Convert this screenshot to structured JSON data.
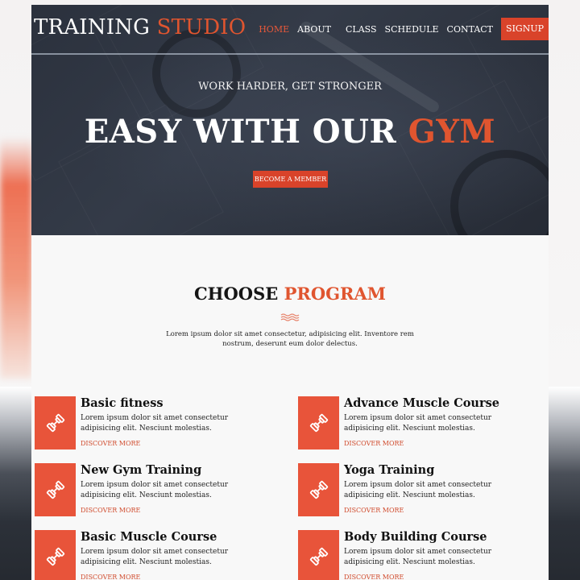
{
  "brand": {
    "name": "TRAINING",
    "accent": "STUDIO"
  },
  "nav": {
    "items": [
      "HOME",
      "ABOUT",
      "CLASS",
      "SCHEDULE",
      "CONTACT"
    ],
    "signup": "SIGNUP"
  },
  "hero": {
    "subtitle": "WORK HARDER, GET STRONGER",
    "title": "EASY WITH OUR",
    "title_accent": "GYM",
    "button": "BECOME A MEMBER"
  },
  "programs_section": {
    "title": "CHOOSE",
    "title_accent": "PROGRAM",
    "description": "Lorem ipsum dolor sit amet consectetur, adipisicing elit. Inventore rem nostrum, deserunt eum dolor delectus."
  },
  "programs": [
    {
      "title": "Basic fitness",
      "desc": "Lorem ipsum dolor sit amet consectetur adipisicing elit. Nesciunt molestias.",
      "link": "DISCOVER MORE",
      "icon": "dumbbell-icon"
    },
    {
      "title": "Advance Muscle Course",
      "desc": "Lorem ipsum dolor sit amet consectetur adipisicing elit. Nesciunt molestias.",
      "link": "DISCOVER MORE",
      "icon": "dumbbell-icon"
    },
    {
      "title": "New Gym Training",
      "desc": "Lorem ipsum dolor sit amet consectetur adipisicing elit. Nesciunt molestias.",
      "link": "DISCOVER MORE",
      "icon": "dumbbell-icon"
    },
    {
      "title": "Yoga Training",
      "desc": "Lorem ipsum dolor sit amet consectetur adipisicing elit. Nesciunt molestias.",
      "link": "DISCOVER MORE",
      "icon": "dumbbell-icon"
    },
    {
      "title": "Basic Muscle Course",
      "desc": "Lorem ipsum dolor sit amet consectetur adipisicing elit. Nesciunt molestias.",
      "link": "DISCOVER MORE",
      "icon": "dumbbell-icon"
    },
    {
      "title": "Body Building Course",
      "desc": "Lorem ipsum dolor sit amet consectetur adipisicing elit. Nesciunt molestias.",
      "link": "DISCOVER MORE",
      "icon": "dumbbell-icon"
    }
  ],
  "colors": {
    "accent": "#e0552f",
    "button": "#d9432a",
    "hero_bg": "#2b313d"
  }
}
